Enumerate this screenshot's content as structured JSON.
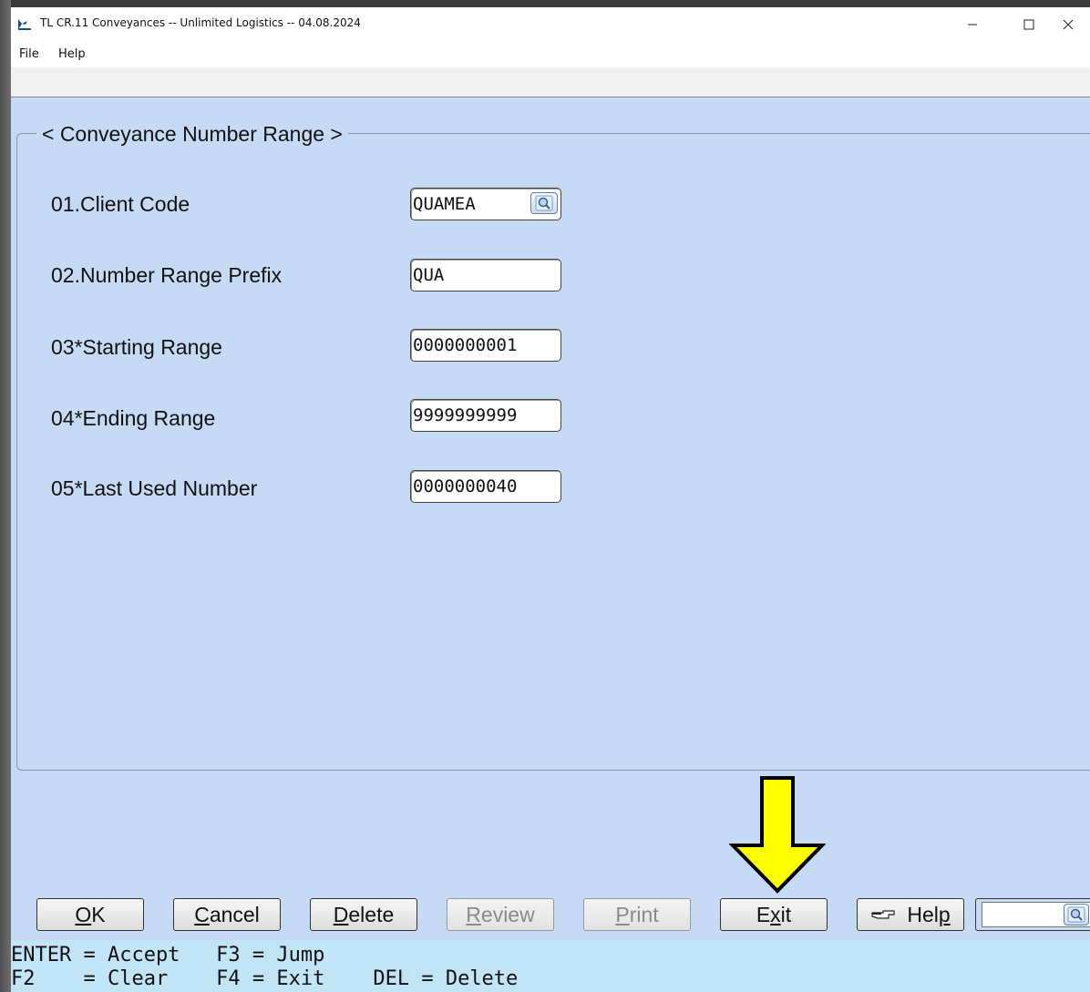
{
  "window": {
    "title": "TL CR.11 Conveyances -- Unlimited Logistics -- 04.08.2024",
    "icon": "app-bird-icon"
  },
  "menu": [
    "File",
    "Help"
  ],
  "group": {
    "title": "< Conveyance Number Range >"
  },
  "fields": [
    {
      "label": "01.Client Code",
      "value": "QUAMEA",
      "lookup": true
    },
    {
      "label": "02.Number Range Prefix",
      "value": "QUA"
    },
    {
      "label": "03*Starting Range",
      "value": "0000000001"
    },
    {
      "label": "04*Ending Range",
      "value": "9999999999"
    },
    {
      "label": "05*Last Used Number",
      "value": "0000000040"
    }
  ],
  "buttons": {
    "ok": {
      "before": "",
      "mnemonic": "O",
      "after": "K"
    },
    "cancel": {
      "before": "",
      "mnemonic": "C",
      "after": "ancel"
    },
    "delete": {
      "before": "",
      "mnemonic": "D",
      "after": "elete"
    },
    "review": {
      "before": "",
      "mnemonic": "R",
      "after": "eview"
    },
    "print": {
      "before": "",
      "mnemonic": "P",
      "after": "rint"
    },
    "exit": {
      "before": "E",
      "mnemonic": "x",
      "after": "it"
    },
    "help": {
      "before": "Hel",
      "mnemonic": "p",
      "after": ""
    }
  },
  "status": {
    "line1": "ENTER = Accept   F3 = Jump",
    "line2": "F2    = Clear    F4 = Exit    DEL = Delete"
  },
  "annotation": {
    "color": "#ffff00",
    "icon": "yellow-down-arrow"
  }
}
